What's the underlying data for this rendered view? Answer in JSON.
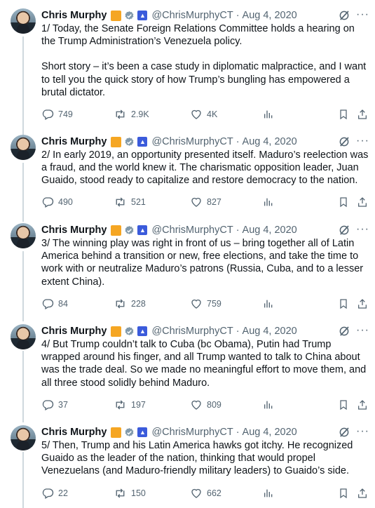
{
  "author": {
    "name": "Chris Murphy",
    "handle": "@ChrisMurphyCT",
    "separator": "·",
    "more": "···"
  },
  "tweets": [
    {
      "date": "Aug 4, 2020",
      "paragraphs": [
        "1/ Today, the Senate Foreign Relations Committee holds a hearing on the Trump Administration’s Venezuela policy.",
        "Short story – it’s been a case study in diplomatic malpractice, and I want to tell you the quick story of how Trump’s bungling has empowered a brutal dictator."
      ],
      "replies": "749",
      "retweets": "2.9K",
      "likes": "4K"
    },
    {
      "date": "Aug 4, 2020",
      "paragraphs": [
        "2/ In early 2019, an opportunity presented itself. Maduro’s reelection was a fraud, and the world knew it. The charismatic opposition leader, Juan Guaido, stood ready to capitalize and restore democracy to the nation."
      ],
      "replies": "490",
      "retweets": "521",
      "likes": "827"
    },
    {
      "date": "Aug 4, 2020",
      "paragraphs": [
        "3/ The winning play was right in front of us – bring together all of Latin America behind a transition or new, free elections, and take the time to work with or neutralize Maduro’s patrons (Russia, Cuba, and to a lesser extent China)."
      ],
      "replies": "84",
      "retweets": "228",
      "likes": "759"
    },
    {
      "date": "Aug 4, 2020",
      "paragraphs": [
        "4/ But Trump couldn’t talk to Cuba (bc Obama), Putin had Trump wrapped around his finger, and all Trump wanted to talk to China about was the trade deal. So we made no meaningful effort to move them, and all three stood solidly behind Maduro."
      ],
      "replies": "37",
      "retweets": "197",
      "likes": "809"
    },
    {
      "date": "Aug 4, 2020",
      "paragraphs": [
        "5/ Then, Trump and his Latin America hawks got itchy. He recognized Guaido as the leader of the nation, thinking that would propel Venezuelans (and Maduro-friendly military leaders) to Guaido’s side."
      ],
      "replies": "22",
      "retweets": "150",
      "likes": "662"
    }
  ],
  "icons": {
    "reply": "reply-icon",
    "retweet": "retweet-icon",
    "like": "like-icon",
    "views": "views-icon",
    "bookmark": "bookmark-icon",
    "share": "share-icon",
    "grok": "grok-icon",
    "verified": "verified-badge-icon",
    "gov": "government-badge-icon"
  },
  "colors": {
    "text": "#0f1419",
    "secondary": "#536471",
    "thread_line": "#cfd9de",
    "badge_orange": "#f5a623",
    "badge_gray": "#829aab",
    "gov_blue": "#3b5bdb"
  }
}
